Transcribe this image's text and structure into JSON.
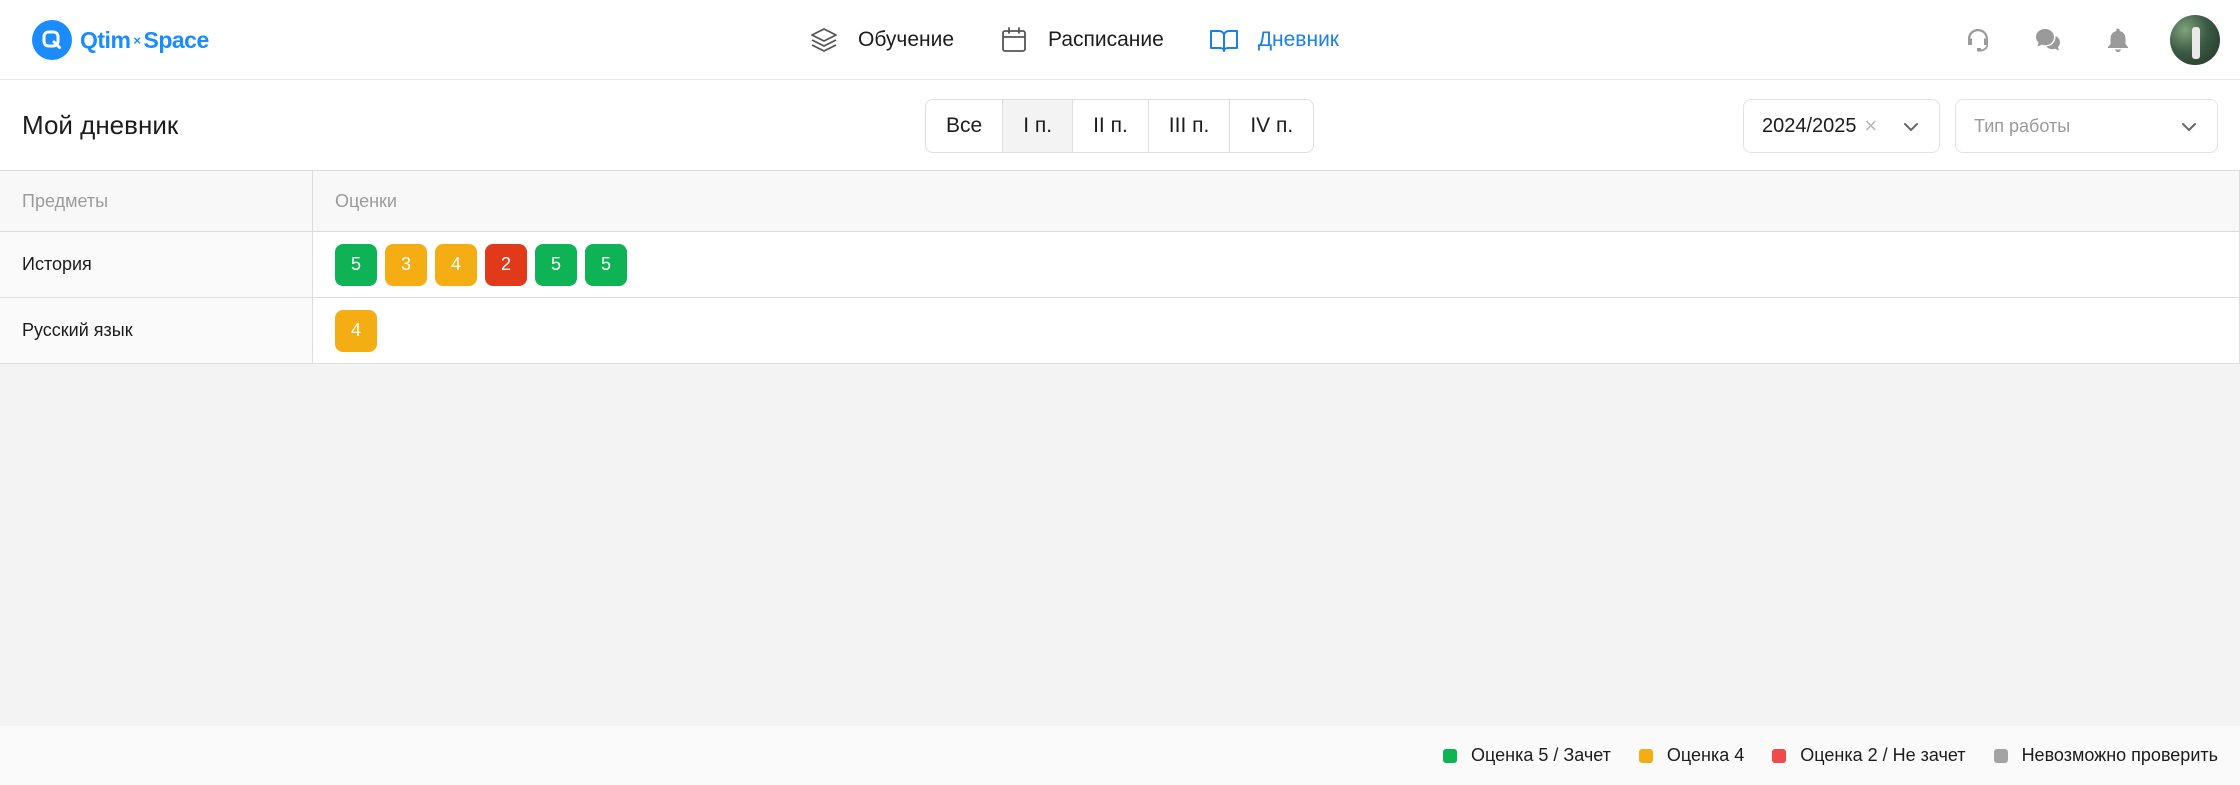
{
  "colors": {
    "accent": "#1a8cff",
    "grade_5": "#0db354",
    "grade_4": "#f5ad14",
    "grade_3": "#f5ad14",
    "grade_2": "#e03a1a",
    "legend_fail": "#ef4a4a",
    "unverifiable": "#a3a3a3"
  },
  "app": {
    "logo_left": "Qtim",
    "logo_sep": "×",
    "logo_right": "Space"
  },
  "nav": [
    {
      "label": "Обучение",
      "icon": "layers-icon",
      "active": false
    },
    {
      "label": "Расписание",
      "icon": "calendar-icon",
      "active": false
    },
    {
      "label": "Дневник",
      "icon": "book-open-icon",
      "active": true
    }
  ],
  "top_actions": [
    "headset-icon",
    "chat-icon",
    "bell-icon",
    "avatar"
  ],
  "page": {
    "title": "Мой дневник"
  },
  "periods": [
    {
      "label": "Все",
      "active": false
    },
    {
      "label": "I п.",
      "active": true
    },
    {
      "label": "II п.",
      "active": false
    },
    {
      "label": "III п.",
      "active": false
    },
    {
      "label": "IV п.",
      "active": false
    }
  ],
  "filters": {
    "year": {
      "value": "2024/2025",
      "clear": "×"
    },
    "work_type": {
      "placeholder": "Тип работы"
    }
  },
  "table": {
    "headers": {
      "subject": "Предметы",
      "grades": "Оценки"
    },
    "rows": [
      {
        "subject": "История",
        "grades": [
          "5",
          "3",
          "4",
          "2",
          "5",
          "5"
        ]
      },
      {
        "subject": "Русский язык",
        "grades": [
          "4"
        ]
      }
    ]
  },
  "legend": [
    {
      "label": "Оценка 5 / Зачет",
      "color": "#0db354"
    },
    {
      "label": "Оценка 4",
      "color": "#f5ad14"
    },
    {
      "label": "Оценка 2 / Не зачет",
      "color": "#ef4a4a"
    },
    {
      "label": "Невозможно проверить",
      "color": "#a3a3a3"
    }
  ]
}
